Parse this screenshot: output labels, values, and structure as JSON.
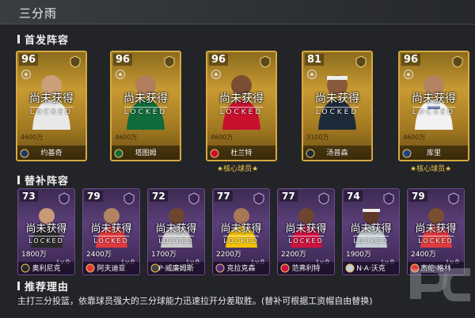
{
  "header": {
    "title": "三分雨"
  },
  "sections": {
    "starting": "首发阵容",
    "bench": "替补阵容",
    "reason": "推荐理由"
  },
  "unobtained_text": "尚未获得",
  "locked_text": "LOCKED",
  "core_label": "★核心球员★",
  "starters": [
    {
      "rating": "96",
      "salary": "4600万",
      "name": "约基奇",
      "core": false
    },
    {
      "rating": "96",
      "salary": "4600万",
      "name": "塔图姆",
      "core": false
    },
    {
      "rating": "96",
      "salary": "4600万",
      "name": "杜兰特",
      "core": true
    },
    {
      "rating": "81",
      "salary": "3100万",
      "name": "汤普森",
      "core": false
    },
    {
      "rating": "96",
      "salary": "4600万",
      "name": "库里",
      "core": true
    }
  ],
  "bench": [
    {
      "rating": "73",
      "salary": "1800万",
      "name": "奥利尼克",
      "lv": "Lv.0"
    },
    {
      "rating": "79",
      "salary": "2400万",
      "name": "阿夫迪亚",
      "lv": "Lv.0"
    },
    {
      "rating": "72",
      "salary": "1700万",
      "name": "P·威廉姆斯",
      "lv": "Lv.0"
    },
    {
      "rating": "77",
      "salary": "2200万",
      "name": "克拉克森",
      "lv": "Lv.0"
    },
    {
      "rating": "77",
      "salary": "2200万",
      "name": "范弗利特",
      "lv": "Lv.0"
    },
    {
      "rating": "74",
      "salary": "1900万",
      "name": "N·A·沃克",
      "lv": "Lv.0"
    },
    {
      "rating": "79",
      "salary": "2400万",
      "name": "杰伦·格林",
      "lv": "Lv.0"
    }
  ],
  "reason_text": "主打三分投篮，依靠球员强大的三分球能力迅速拉开分差取胜。(替补可根据工资帽自由替换)",
  "colors": {
    "gold": "#c89a33",
    "purple": "#5a3f78",
    "core": "#f2c84b"
  }
}
